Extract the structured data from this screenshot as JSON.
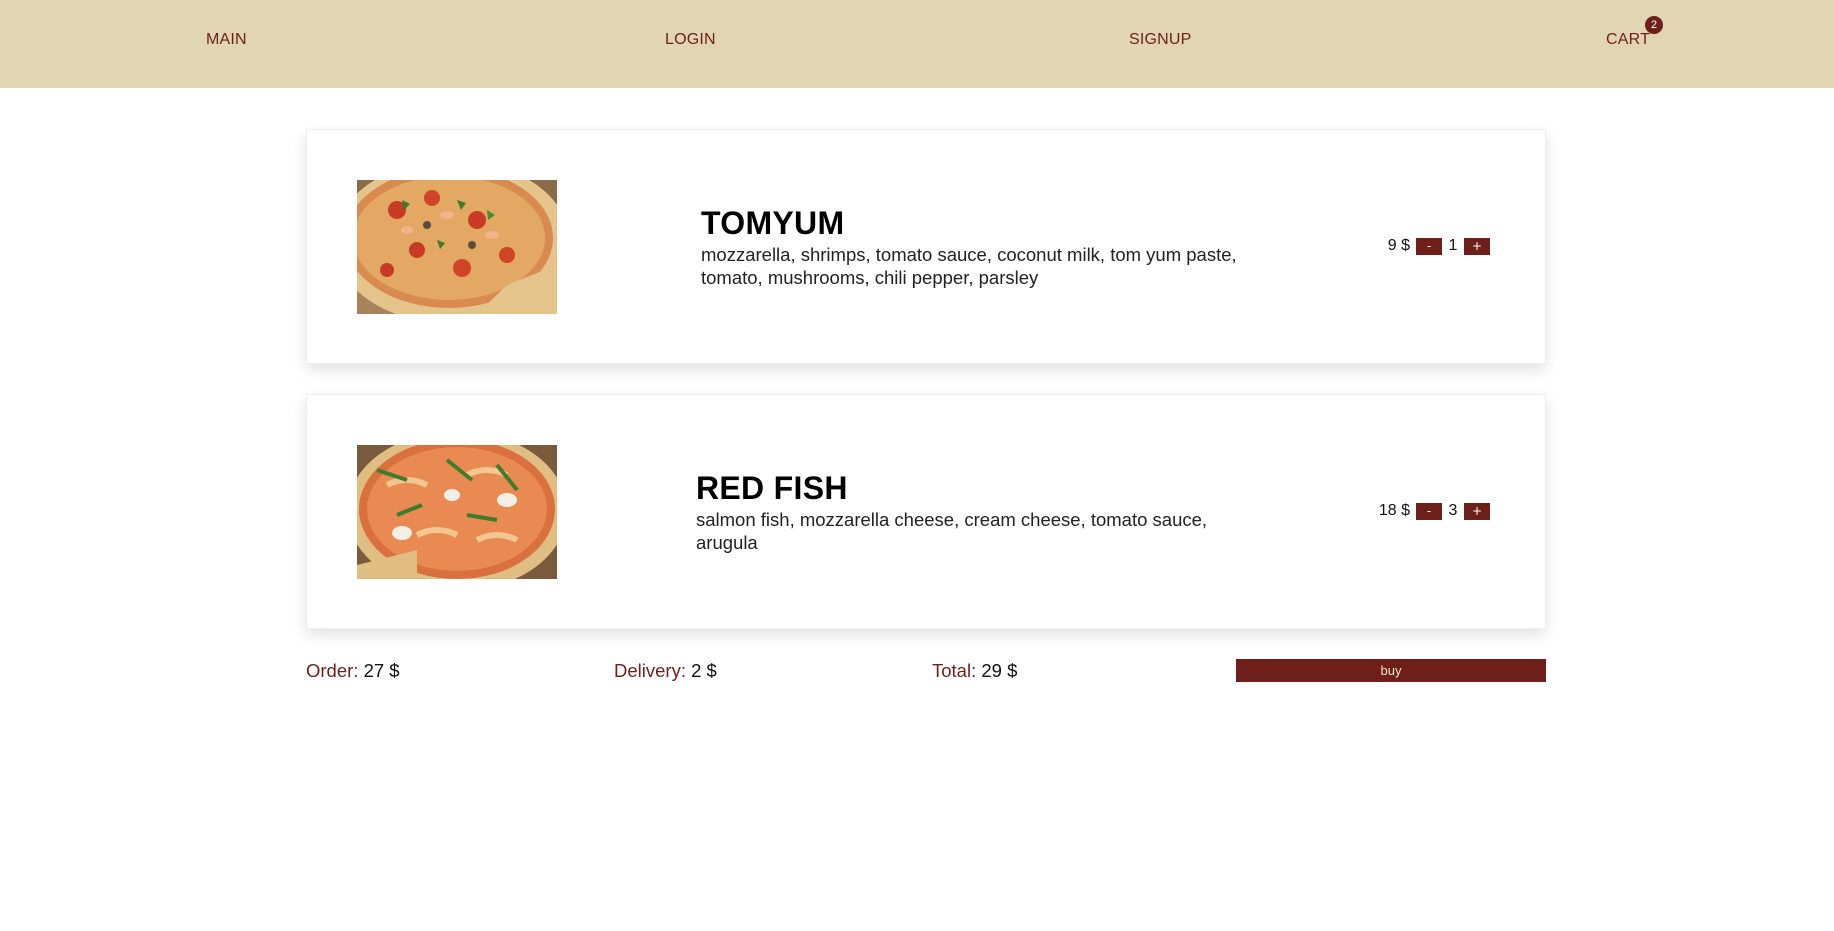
{
  "nav": {
    "main": "MAIN",
    "login": "LOGIN",
    "signup": "SIGNUP",
    "cart": "CART",
    "cart_count": "2"
  },
  "items": [
    {
      "name": "TOMYUM",
      "description": "mozzarella, shrimps, tomato sauce, coconut milk, tom yum paste, tomato, mushrooms, chili pepper, parsley",
      "price": "9 $",
      "quantity": "1",
      "minus": "-",
      "plus": "+"
    },
    {
      "name": "RED FISH",
      "description": "salmon fish, mozzarella cheese, cream cheese, tomato sauce, arugula",
      "price": "18 $",
      "quantity": "3",
      "minus": "-",
      "plus": "+"
    }
  ],
  "summary": {
    "order_label": "Order:",
    "order_value": "27 $",
    "delivery_label": "Delivery:",
    "delivery_value": "2 $",
    "total_label": "Total:",
    "total_value": "29 $",
    "buy_label": "buy"
  },
  "colors": {
    "header_bg": "#e1d5b3",
    "accent": "#6e1f1a"
  }
}
